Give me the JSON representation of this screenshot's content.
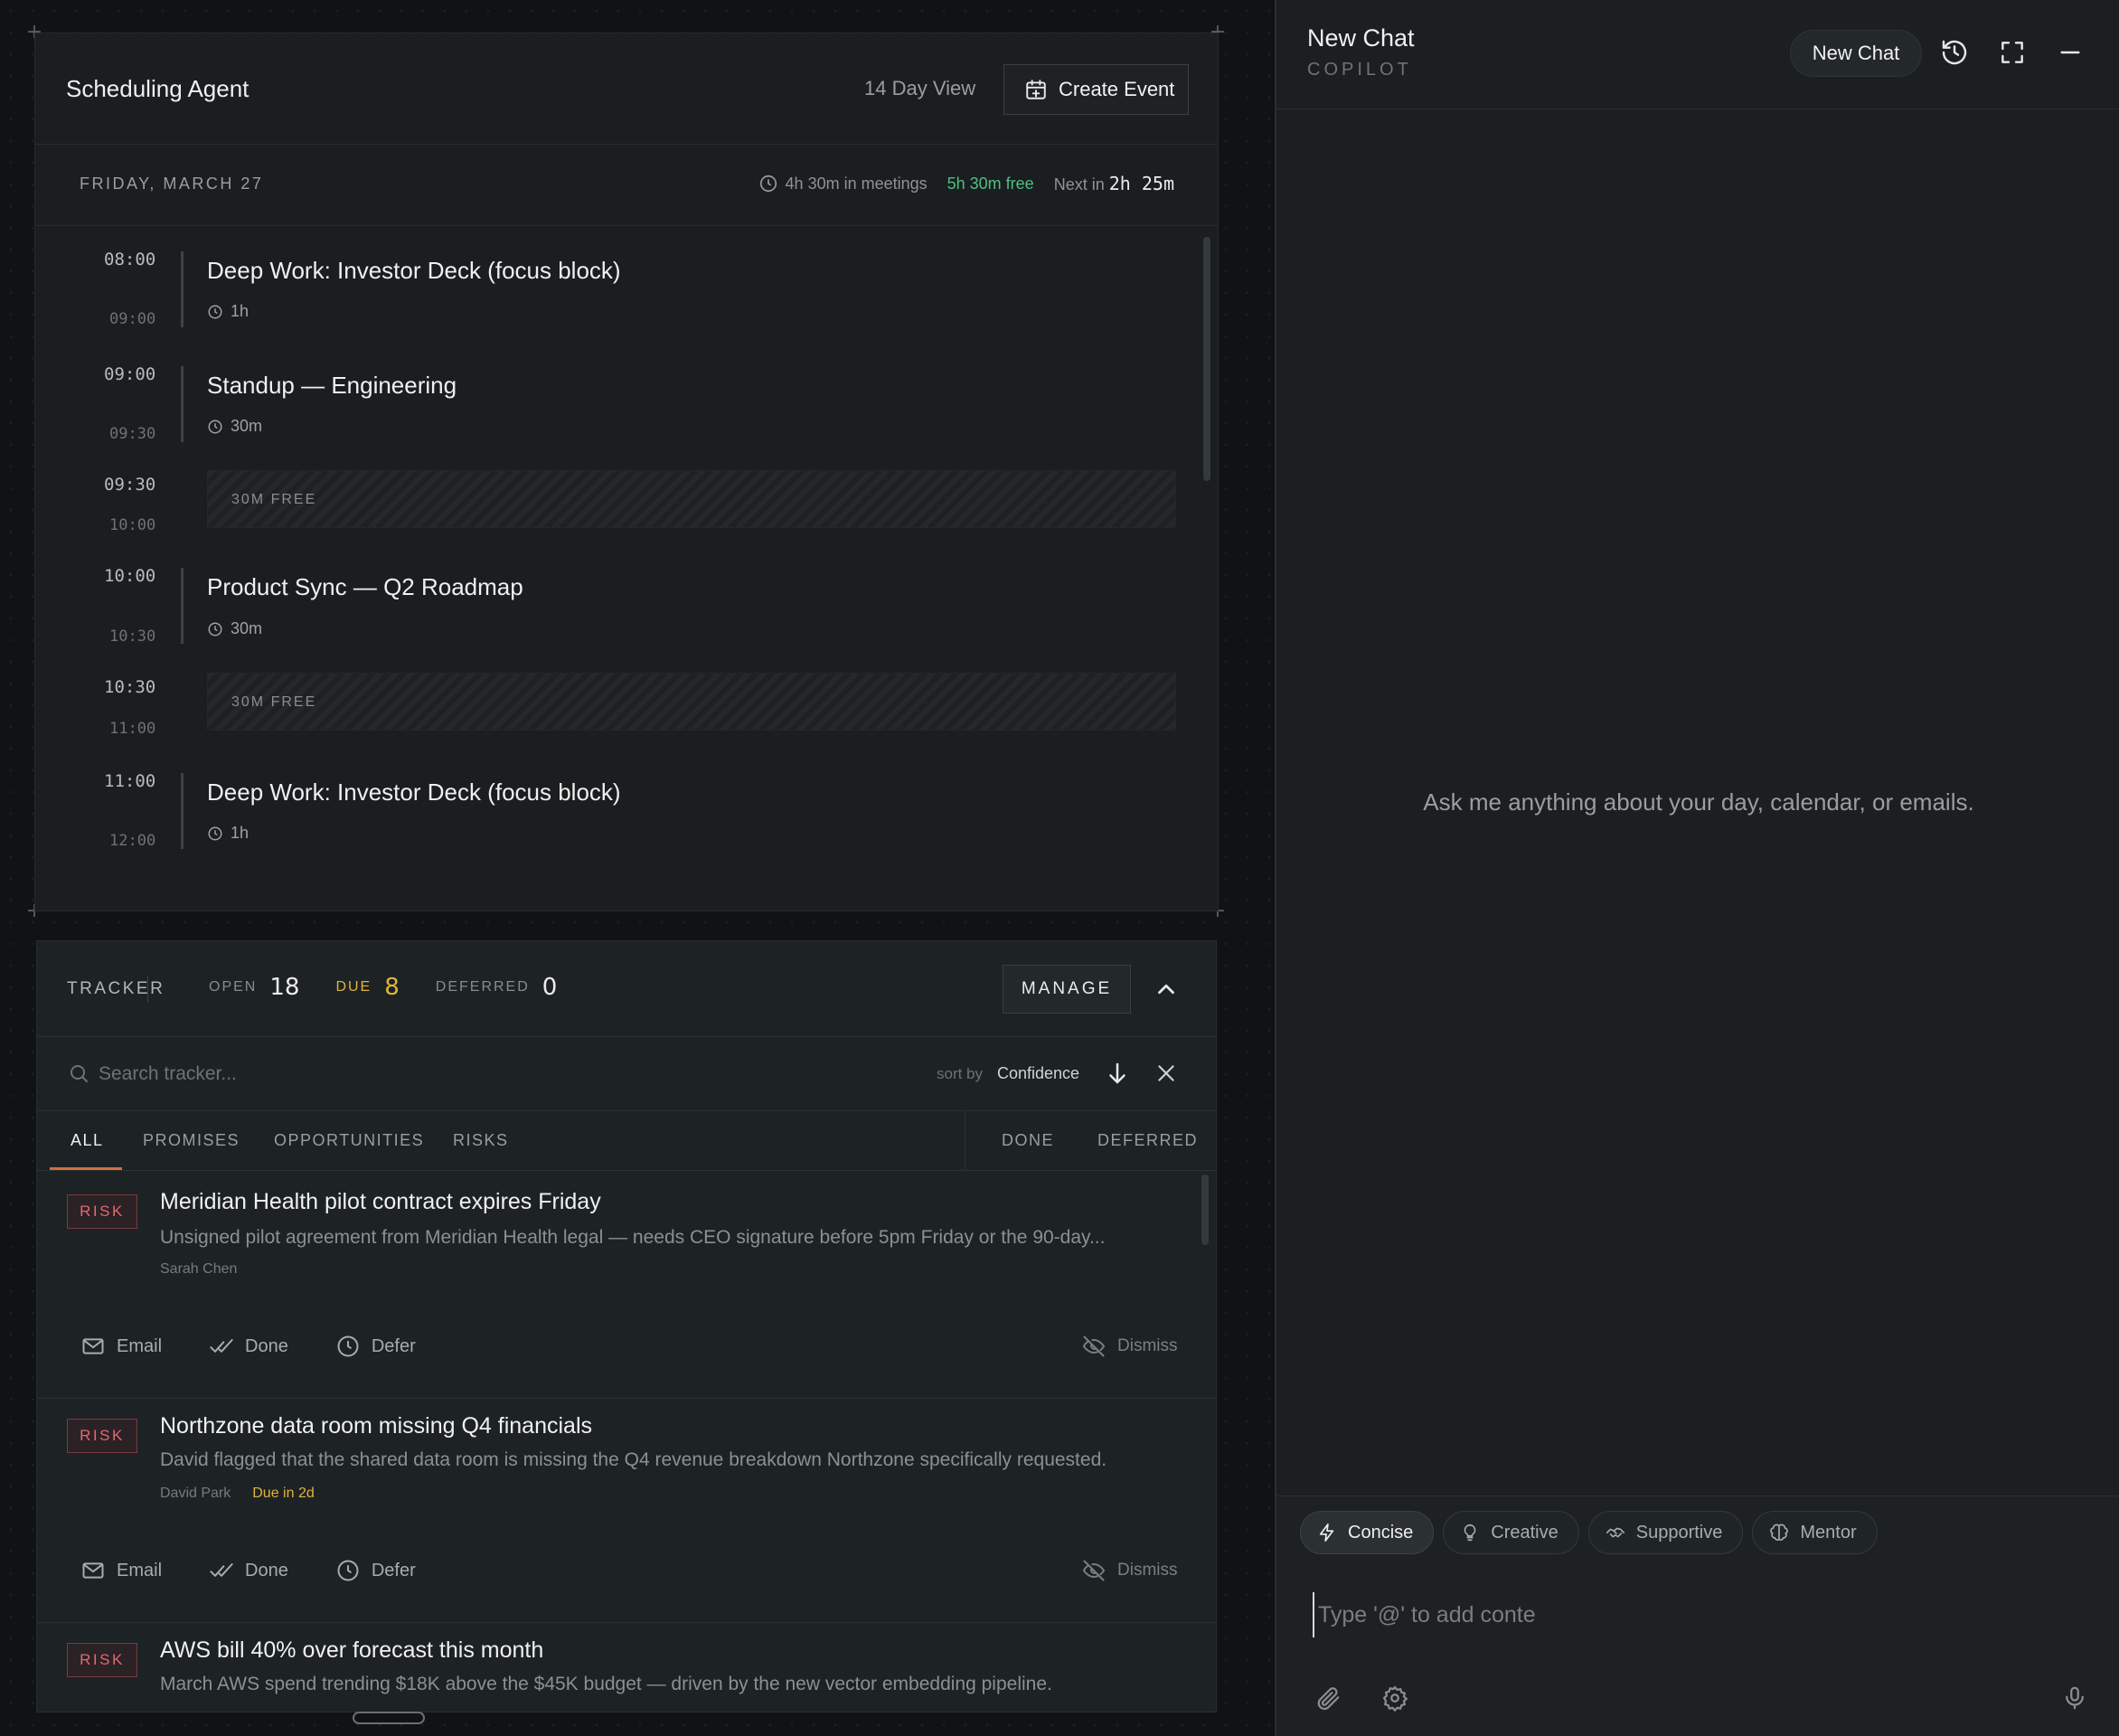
{
  "scheduler": {
    "title": "Scheduling Agent",
    "view_label": "14 Day View",
    "create_label": "Create Event",
    "date": "FRIDAY, MARCH 27",
    "meetings": "4h 30m in meetings",
    "free": "5h 30m free",
    "next_prefix": "Next in",
    "next_value": "2h 25m",
    "slots": [
      {
        "start": "08:00",
        "end": "09:00",
        "title": "Deep Work: Investor Deck (focus block)",
        "duration": "1h"
      },
      {
        "start": "09:00",
        "end": "09:30",
        "title": "Standup — Engineering",
        "duration": "30m"
      },
      {
        "start": "09:30",
        "end": "10:00",
        "free_label": "30M FREE"
      },
      {
        "start": "10:00",
        "end": "10:30",
        "title": "Product Sync — Q2 Roadmap",
        "duration": "30m"
      },
      {
        "start": "10:30",
        "end": "11:00",
        "free_label": "30M FREE"
      },
      {
        "start": "11:00",
        "end": "12:00",
        "title": "Deep Work: Investor Deck (focus block)",
        "duration": "1h"
      }
    ]
  },
  "tracker": {
    "title": "TRACKER",
    "open_label": "OPEN",
    "open_count": "18",
    "due_label": "DUE",
    "due_count": "8",
    "deferred_label": "DEFERRED",
    "deferred_count": "0",
    "manage_label": "MANAGE",
    "search_placeholder": "Search tracker...",
    "sort_label": "sort by",
    "sort_value": "Confidence",
    "tabs": [
      "ALL",
      "PROMISES",
      "OPPORTUNITIES",
      "RISKS"
    ],
    "side_tabs": [
      "DONE",
      "DEFERRED"
    ],
    "items": [
      {
        "badge": "RISK",
        "title": "Meridian Health pilot contract expires Friday",
        "desc": "Unsigned pilot agreement from Meridian Health legal — needs CEO signature before 5pm Friday or the 90-day...",
        "owner": "Sarah Chen",
        "due": ""
      },
      {
        "badge": "RISK",
        "title": "Northzone data room missing Q4 financials",
        "desc": "David flagged that the shared data room is missing the Q4 revenue breakdown Northzone specifically requested.",
        "owner": "David Park",
        "due": "Due in 2d"
      },
      {
        "badge": "RISK",
        "title": "AWS bill 40% over forecast this month",
        "desc": "March AWS spend trending $18K above the $45K budget — driven by the new vector embedding pipeline.",
        "owner": "",
        "due": ""
      }
    ],
    "actions": {
      "email": "Email",
      "done": "Done",
      "defer": "Defer",
      "dismiss": "Dismiss"
    }
  },
  "copilot": {
    "title": "New Chat",
    "subtitle": "COPILOT",
    "new_chat_label": "New Chat",
    "empty_hint": "Ask me anything about your day, calendar, or emails.",
    "modes": [
      "Concise",
      "Creative",
      "Supportive",
      "Mentor"
    ],
    "active_mode": "Concise",
    "input_value": "Type '@' to add conte"
  },
  "colors": {
    "accent": "#d1703f",
    "free_green": "#4fbf83",
    "due_amber": "#e0b43c",
    "risk_red": "#e0696f"
  }
}
